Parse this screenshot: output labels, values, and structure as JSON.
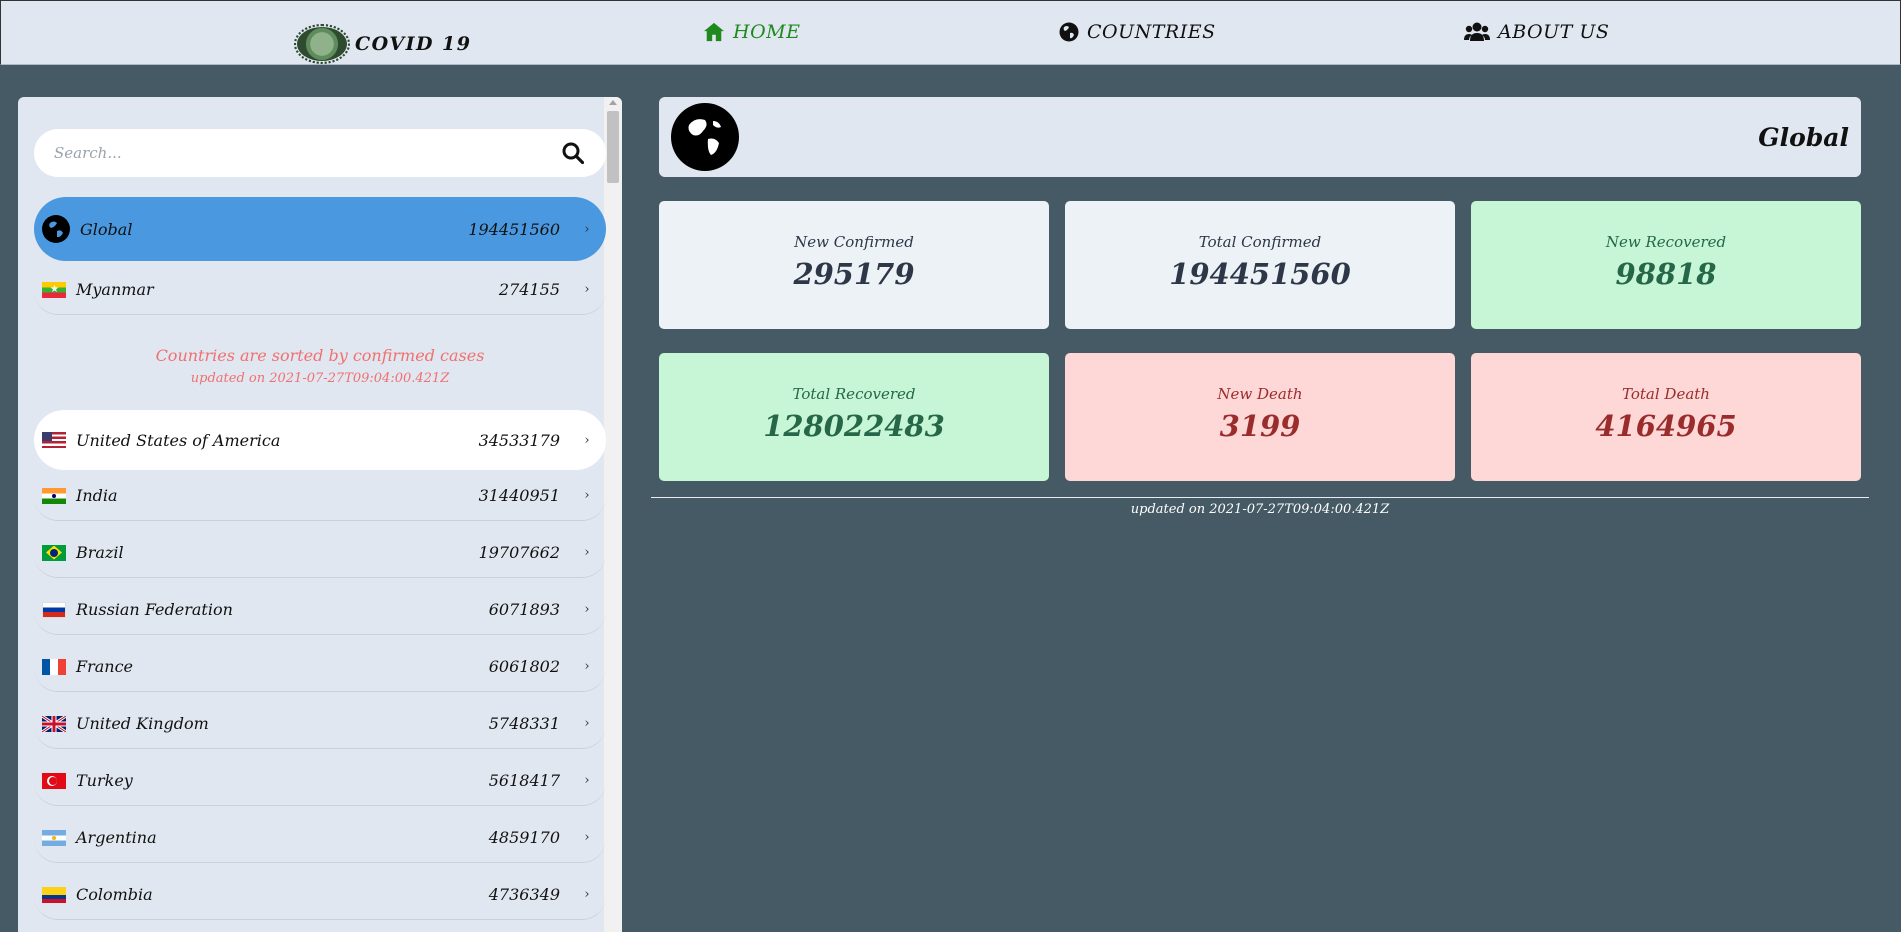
{
  "nav": {
    "brand": "COVID 19",
    "home": "HOME",
    "countries": "COUNTRIES",
    "about": "ABOUT US"
  },
  "search": {
    "placeholder": "Search..."
  },
  "sidebar": {
    "global": {
      "name": "Global",
      "count": "194451560"
    },
    "pinned": {
      "name": "Myanmar",
      "count": "274155"
    },
    "note": "Countries are sorted by confirmed cases",
    "updated": "updated on 2021-07-27T09:04:00.421Z",
    "countries": [
      {
        "name": "United States of America",
        "count": "34533179"
      },
      {
        "name": "India",
        "count": "31440951"
      },
      {
        "name": "Brazil",
        "count": "19707662"
      },
      {
        "name": "Russian Federation",
        "count": "6071893"
      },
      {
        "name": "France",
        "count": "6061802"
      },
      {
        "name": "United Kingdom",
        "count": "5748331"
      },
      {
        "name": "Turkey",
        "count": "5618417"
      },
      {
        "name": "Argentina",
        "count": "4859170"
      },
      {
        "name": "Colombia",
        "count": "4736349"
      }
    ]
  },
  "main": {
    "title": "Global",
    "stats": [
      {
        "label": "New Confirmed",
        "value": "295179"
      },
      {
        "label": "Total Confirmed",
        "value": "194451560"
      },
      {
        "label": "New Recovered",
        "value": "98818"
      },
      {
        "label": "Total Recovered",
        "value": "128022483"
      },
      {
        "label": "New Death",
        "value": "3199"
      },
      {
        "label": "Total Death",
        "value": "4164965"
      }
    ],
    "updated": "updated on 2021-07-27T09:04:00.421Z"
  },
  "colors": {
    "background": "#455a64",
    "panel": "#e1e7f0",
    "active_item": "#4a98e0",
    "nav_active": "#1e8a1e",
    "note": "#f07070"
  }
}
